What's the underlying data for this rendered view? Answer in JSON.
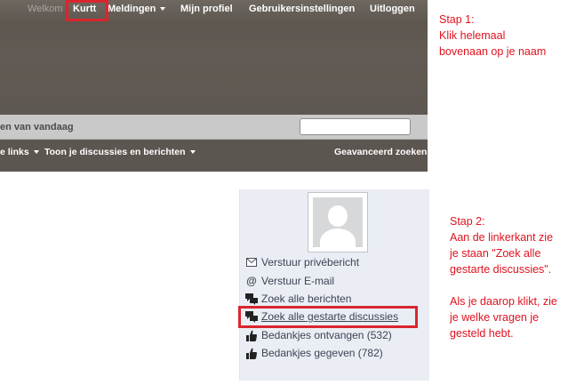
{
  "navbar": {
    "welcome": "Welkom",
    "user": "Kurtt",
    "notifications": "Meldingen",
    "profile": "Mijn profiel",
    "settings": "Gebruikersinstellingen",
    "logout": "Uitloggen"
  },
  "subbar": {
    "today": "en van vandaag"
  },
  "linkbar": {
    "quick_links": "e links",
    "show_threads": "Toon je discussies en berichten",
    "advanced_search": "Geavanceerd zoeken"
  },
  "step1": {
    "title": "Stap 1:",
    "line1": "Klik helemaal",
    "line2": "bovenaan op je naam"
  },
  "step2": {
    "title": "Stap 2:",
    "line1": "Aan de linkerkant zie",
    "line2": "je staan \"Zoek alle",
    "line3": "gestarte discussies\".",
    "line4": "Als je daarop klikt, zie",
    "line5": "je welke vragen je",
    "line6": "gesteld hebt."
  },
  "profile_menu": {
    "private_message": "Verstuur privébericht",
    "email": "Verstuur E-mail",
    "all_posts": "Zoek alle berichten",
    "all_threads": "Zoek alle gestarte discussies",
    "thanks_received": "Bedankjes ontvangen (532)",
    "thanks_given": "Bedankjes gegeven (782)"
  },
  "colors": {
    "annotation_red": "#e0121d",
    "highlight_red": "#d9262e",
    "nav_bg": "#5e5852",
    "panel_bg": "#eaedf4"
  }
}
